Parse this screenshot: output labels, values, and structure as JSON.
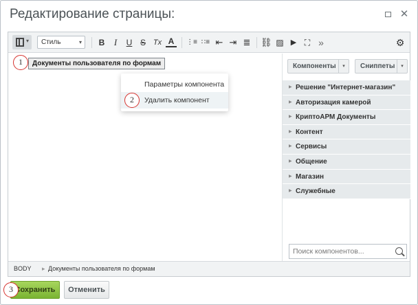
{
  "dialog": {
    "title": "Редактирование страницы:"
  },
  "toolbar": {
    "style_select": "Стиль",
    "icons": [
      "view-mode-icon",
      "bold-icon",
      "italic-icon",
      "underline-icon",
      "strikethrough-icon",
      "clear-format-icon",
      "font-color-icon",
      "ordered-list-icon",
      "unordered-list-icon",
      "outdent-icon",
      "indent-icon",
      "align-icon",
      "link-icon",
      "image-icon",
      "video-icon",
      "fullscreen-icon",
      "more-icon",
      "settings-icon"
    ],
    "bold_label": "B",
    "italic_label": "I",
    "underline_label": "U",
    "strike_label": "S",
    "clear_label": "Tx",
    "color_label": "A",
    "more_label": "»"
  },
  "content": {
    "component_chip": "Документы пользователя по формам"
  },
  "context_menu": {
    "items": [
      "Параметры компонента",
      "Удалить компонент"
    ]
  },
  "badges": [
    "1",
    "2",
    "3"
  ],
  "sidepanel": {
    "components_button": "Компоненты",
    "snippets_button": "Сниппеты",
    "items": [
      "Решение \"Интернет-магазин\"",
      "Авторизация камерой",
      "КриптоАРМ Документы",
      "Контент",
      "Сервисы",
      "Общение",
      "Магазин",
      "Служебные"
    ],
    "search_placeholder": "Поиск компонентов..."
  },
  "statusbar": {
    "body_tag": "BODY",
    "separator": "▸",
    "path": "Документы пользователя по формам"
  },
  "footer": {
    "save_label": "Сохранить",
    "cancel_label": "Отменить"
  },
  "colors": {
    "save_button": "#8cc63f",
    "badge_border": "#d6322e",
    "panel_item": "#e6eaec"
  }
}
